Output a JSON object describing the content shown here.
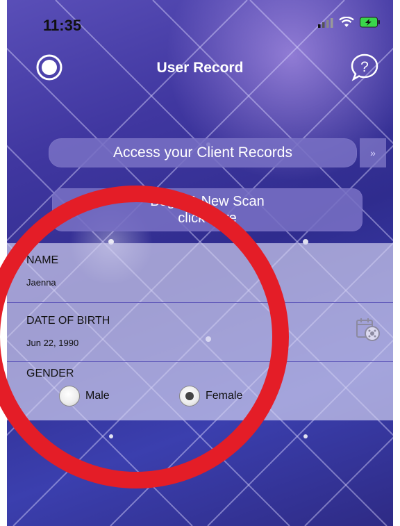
{
  "status_bar": {
    "time": "11:35",
    "icons": [
      "cellular-signal-icon",
      "wifi-icon",
      "battery-charging-icon"
    ],
    "battery_color": "#3ad64a"
  },
  "nav": {
    "title": "User Record",
    "left_icon": "record-circle-icon",
    "right_icon": "help-bubble-icon"
  },
  "actions": {
    "access_label": "Access your Client Records",
    "access_arrow": "»",
    "scan_line1": "Begin A New Scan",
    "scan_line2": "click here"
  },
  "form": {
    "name_label": "NAME",
    "name_value": "Jaenna",
    "dob_label": "DATE OF BIRTH",
    "dob_value": "Jun 22, 1990",
    "calendar_icon": "calendar-clock-icon",
    "gender_label": "GENDER",
    "gender_options": [
      "Male",
      "Female"
    ],
    "gender_selected": "Female"
  },
  "colors": {
    "annotation_circle": "#e41d27",
    "background": "#3b35a0",
    "pill": "#7870c4"
  }
}
